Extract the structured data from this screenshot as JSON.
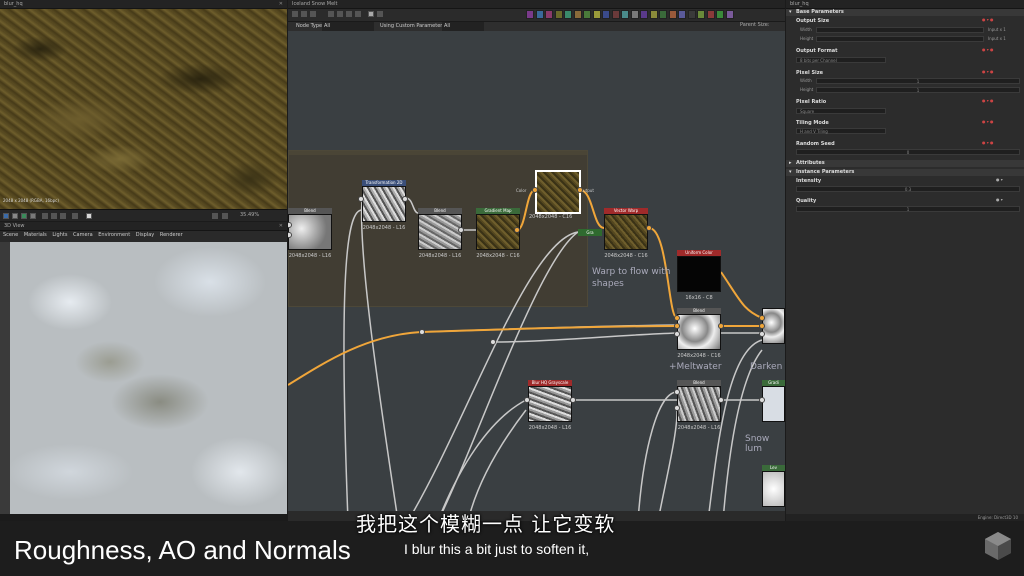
{
  "view2d": {
    "title": "blur_hq",
    "resolution": "2048 x 2048 (RGBA, 16bpc)",
    "zoom": "35.49%"
  },
  "view3d": {
    "title": "3D View",
    "menu": [
      "Scene",
      "Materials",
      "Lights",
      "Camera",
      "Environment",
      "Display",
      "Renderer"
    ]
  },
  "graph": {
    "title": "Iceland Snow Melt",
    "node_type_label": "Node Type",
    "node_type_value": "All",
    "params_label": "Using Custom Parameters",
    "params_value": "All",
    "parent_size": "Parent Size:",
    "tags": [
      {
        "color": "#7a3a8a"
      },
      {
        "color": "#3a6a9a"
      },
      {
        "color": "#8a3a6a"
      },
      {
        "color": "#6a6a2a"
      },
      {
        "color": "#3a8a6a"
      },
      {
        "color": "#8a6a3a"
      },
      {
        "color": "#4a7a3a"
      },
      {
        "color": "#9a9a3a"
      },
      {
        "color": "#3a4a8a"
      },
      {
        "color": "#6a3a3a"
      },
      {
        "color": "#4a8a8a"
      },
      {
        "color": "#7a7a7a"
      },
      {
        "color": "#5a3a8a"
      },
      {
        "color": "#8a8a3a"
      },
      {
        "color": "#3a6a3a"
      },
      {
        "color": "#9a5a3a"
      },
      {
        "color": "#5a5a9a"
      },
      {
        "color": "#3a3a3a"
      },
      {
        "color": "#6a8a3a"
      },
      {
        "color": "#8a3a3a"
      },
      {
        "color": "#3a8a3a"
      },
      {
        "color": "#7a5a9a"
      }
    ],
    "nodes": {
      "blend_a": {
        "title": "Blend",
        "size": "2048x2048 - L16"
      },
      "transformation": {
        "title": "Transformation 2D",
        "size": "2048x2048 - L16"
      },
      "blend_b": {
        "title": "Blend",
        "size": "2048x2048 - L16"
      },
      "gradient_map": {
        "title": "Gradient Map",
        "size": "2048x2048 - C16"
      },
      "selected": {
        "size": "2048x2048 - C16",
        "in": "Color",
        "out": "Output"
      },
      "vector_warp": {
        "title": "Vector Warp",
        "size": "2048x2048 - C16"
      },
      "uniform_color": {
        "title": "Uniform Color",
        "size": "16x16 - C8"
      },
      "blend_c": {
        "title": "Blend",
        "size": "2048x2048 - C16"
      },
      "blur_gray": {
        "title": "Blur HQ Grayscale",
        "size": "2048x2048 - L16"
      },
      "blend_d": {
        "title": "Blend",
        "size": "2048x2048 - L16"
      },
      "gradient_right": {
        "title": "Gradi"
      },
      "levels_right": {
        "title": "Lev"
      }
    },
    "small_node": "Gra",
    "comments": {
      "warp": "Warp to flow with shapes",
      "meltwater": "+Meltwater",
      "darken": "Darken",
      "snow": "Snow lum"
    }
  },
  "params": {
    "title": "blur_hq",
    "base_section": "Base Parameters",
    "output_size": "Output Size",
    "width": "Width",
    "height": "Height",
    "input_x1": "Input x 1",
    "output_format": "Output Format",
    "output_format_value": "8 bits per Channel",
    "pixel_size": "Pixel Size",
    "one": "1",
    "pixel_ratio": "Pixel Ratio",
    "pixel_ratio_value": "Square",
    "tiling_mode": "Tiling Mode",
    "tiling_value": "H and V Tiling",
    "random_seed": "Random Seed",
    "seed_value": "0",
    "attributes": "Attributes",
    "instance": "Instance Parameters",
    "intensity": "Intensity",
    "intensity_value": "0.3",
    "quality": "Quality",
    "quality_value": "1",
    "engine": "Engine: Direct3D 10"
  },
  "bottom": {
    "heading": "Roughness, AO and Normals",
    "subtitle_en": "I blur this a bit just to soften it,",
    "subtitle_zh": "我把这个模糊一点 让它变软"
  },
  "colors": {
    "accent_wire": "#f0a63a",
    "frame": "#413d33",
    "graph_bg": "#3a3f42"
  }
}
